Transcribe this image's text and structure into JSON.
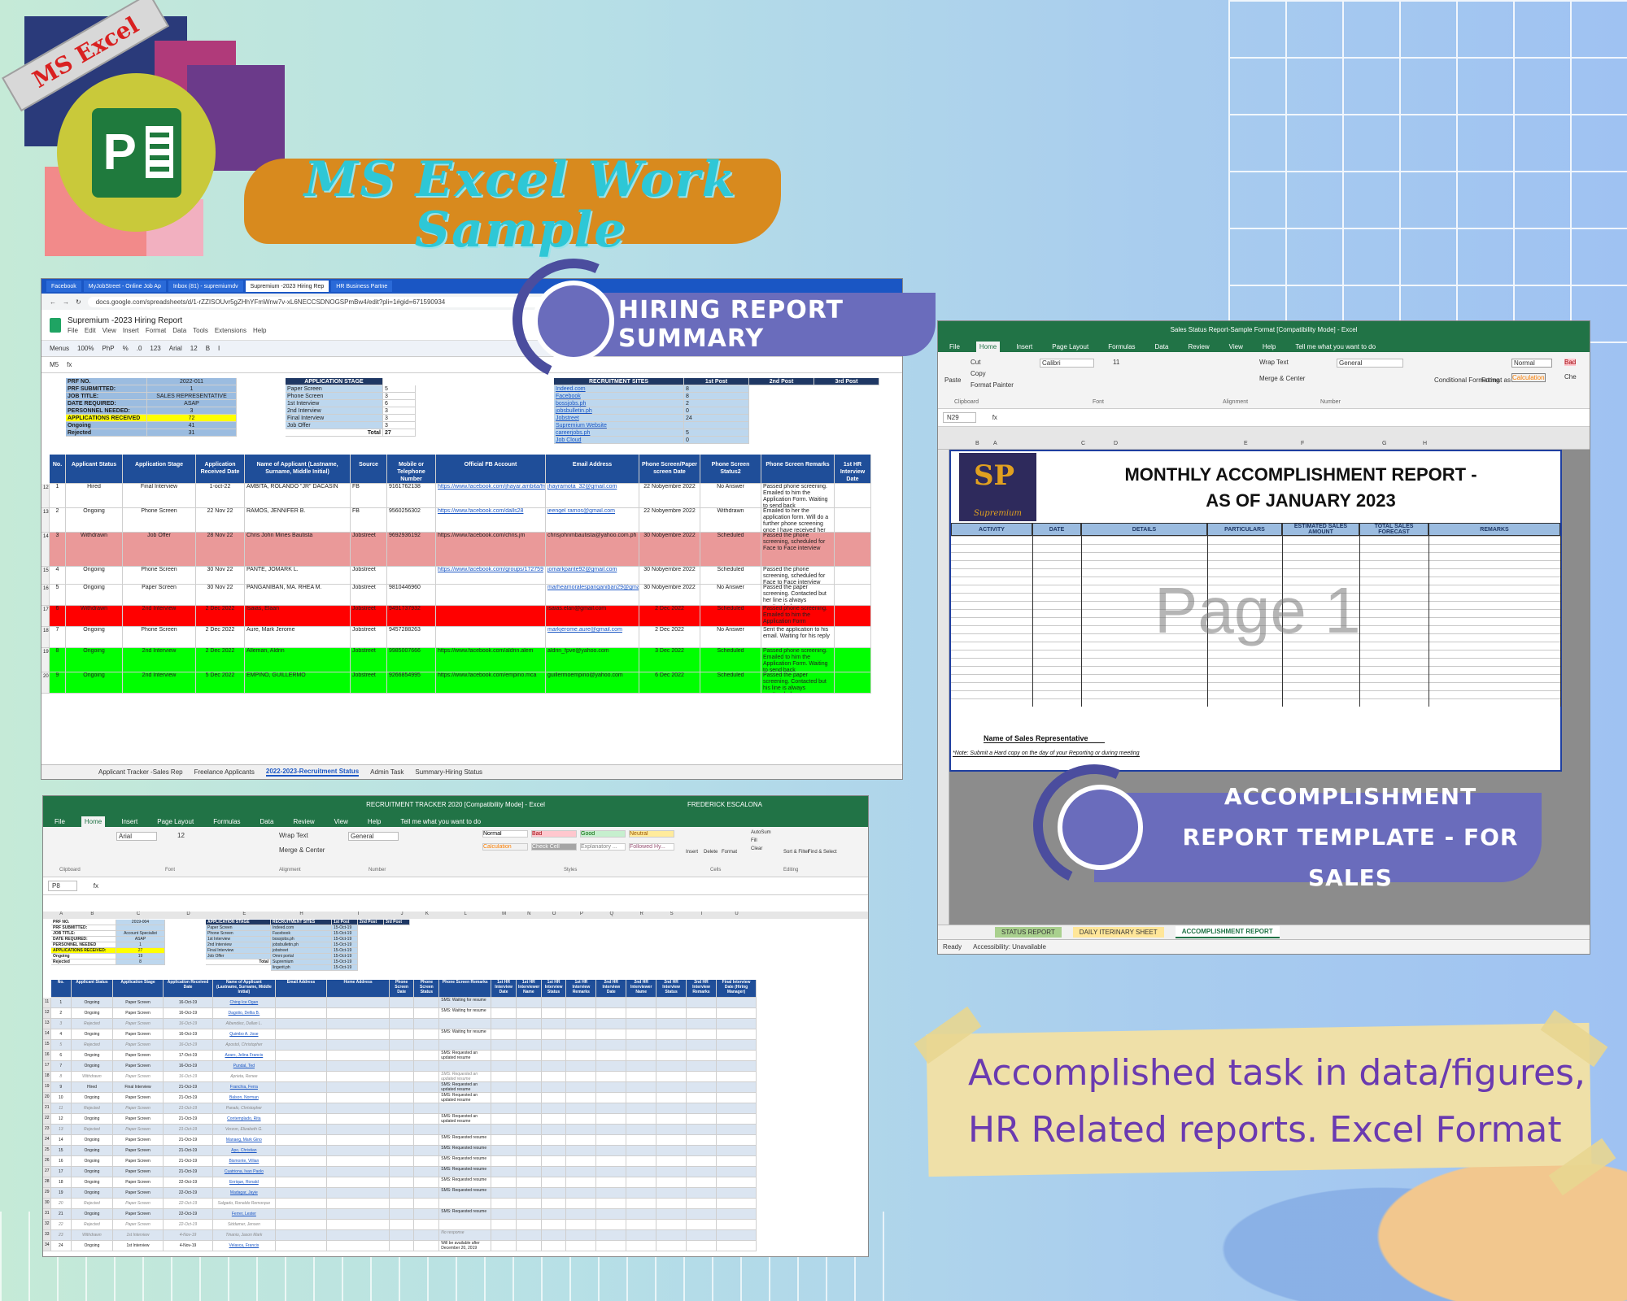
{
  "logo": {
    "ribbon_text": "MS Excel",
    "letter": "P"
  },
  "title": "MS Excel Work Sample",
  "labels": {
    "hiring": "HIRING REPORT SUMMARY",
    "accomplishment": "ACCOMPLISHMENT REPORT TEMPLATE - FOR SALES"
  },
  "note": "Accomplished task in data/figures, HR Related reports. Excel Format",
  "hiring_window": {
    "tabs": [
      "Facebook",
      "MyJobStreet - Online Job Ap",
      "Inbox (81) - supremiumdv",
      "Supremium -2023 Hiring Rep",
      "HR Business Partne"
    ],
    "url": "docs.google.com/spreadsheets/d/1-rZZISOUvr5gZHhYFmWnw7v-xL6NECCSDNOGSPmBw4/edit?pli=1#gid=671590934",
    "doc_title": "Supremium -2023 Hiring Report",
    "menu": [
      "File",
      "Edit",
      "View",
      "Insert",
      "Format",
      "Data",
      "Tools",
      "Extensions",
      "Help"
    ],
    "toolbar": [
      "Menus",
      "100%",
      "PhP",
      "%",
      ".0",
      "123",
      "Arial",
      "12",
      "B",
      "I"
    ],
    "cell_ref": "M5",
    "summary": [
      {
        "label": "PRF NO.",
        "value": "2022-011"
      },
      {
        "label": "PRF SUBMITTED:",
        "value": "1"
      },
      {
        "label": "JOB TITLE:",
        "value": "SALES REPRESENTATIVE"
      },
      {
        "label": "DATE REQUIRED:",
        "value": "ASAP"
      },
      {
        "label": "PERSONNEL NEEDED:",
        "value": "3"
      },
      {
        "label": "APPLICATIONS RECEIVED",
        "value": "72"
      },
      {
        "label": "Ongoing",
        "value": "41"
      },
      {
        "label": "Rejected",
        "value": "31"
      }
    ],
    "stage_header": "APPLICATION STAGE",
    "stages": [
      "Paper Screen",
      "Phone Screen",
      "1st Interview",
      "2nd Interview",
      "Final Interview",
      "Job Offer"
    ],
    "stage_counts": [
      "5",
      "3",
      "6",
      "3",
      "3",
      "3"
    ],
    "stage_total_label": "Total",
    "stage_total": "27",
    "sites_header": "RECRUITMENT SITES",
    "sites": [
      "Indeed.com",
      "Facebook",
      "bossjobs.ph",
      "jobsbulletin.ph",
      "Jobstreet",
      "Supremium Website",
      "careerjobs.ph",
      "Job Cloud"
    ],
    "site_counts": [
      "8",
      "8",
      "2",
      "0",
      "24",
      "",
      "5",
      "0"
    ],
    "post_headers": [
      "1st Post",
      "2nd Post",
      "3rd Post"
    ],
    "columns": [
      "No.",
      "Applicant Status",
      "Application Stage",
      "Application Received Date",
      "Name of Applicant (Lastname, Surname, Middle Initial)",
      "Source",
      "Mobile or Telephone Number",
      "Official FB Account",
      "Email Address",
      "Phone Screen/Paper screen Date",
      "Phone Screen Status2",
      "Phone Screen Remarks",
      "1st HR Interview Date"
    ],
    "rows": [
      {
        "no": "1",
        "status": "Hired",
        "stage": "Final Interview",
        "date": "1-oct-22",
        "name": "AMBITA, ROLANDO \"JR\" DACASIN",
        "source": "FB",
        "phone": "9161762138",
        "fb": "https://www.facebook.com/jhayar.ambita/friends",
        "email": "jhayramota_32@gmail.com",
        "ps_date": "22 Nobyembre 2022",
        "ps_status": "No Answer",
        "remarks": "Passed phone screening. Emailed to him the Application Form. Waiting to send back",
        "color": "#ffffff"
      },
      {
        "no": "2",
        "status": "Ongoing",
        "stage": "Phone Screen",
        "date": "22 Nov 22",
        "name": "RAMOS, JENNIFER B.",
        "source": "FB",
        "phone": "9560256302",
        "fb": "https://www.facebook.com/dalls28",
        "email": "jeengel ramos@gmail.com",
        "ps_date": "22 Nobyembre 2022",
        "ps_status": "Withdrawn",
        "remarks": "Emailed to her the application form. Will do a further phone screening once I have received her filled up form",
        "color": "#ffffff"
      },
      {
        "no": "3",
        "status": "Withdrawn",
        "stage": "Job Offer",
        "date": "28 Nov 22",
        "name": "Chris John Mines Bautista",
        "source": "Jobstreet",
        "phone": "9692936192",
        "fb": "https://www.facebook.com/chris.jm",
        "email": "chrisjohnmbautista@yahoo.com.ph",
        "ps_date": "30 Nobyembre 2022",
        "ps_status": "Scheduled",
        "remarks": "Passed the phone screening, scheduled for Face to Face interview",
        "color": "#ea9999"
      },
      {
        "no": "4",
        "status": "Ongoing",
        "stage": "Phone Screen",
        "date": "30 Nov 22",
        "name": "PANTE, JOMARK L.",
        "source": "Jobstreet",
        "phone": "",
        "fb": "https://www.facebook.com/groups/172759",
        "email": "jomarkpante92@gmail.com",
        "ps_date": "30 Nobyembre 2022",
        "ps_status": "Scheduled",
        "remarks": "Passed the phone screening, scheduled for Face to Face interview",
        "color": "#ffffff"
      },
      {
        "no": "5",
        "status": "Ongoing",
        "stage": "Paper Screen",
        "date": "30 Nov 22",
        "name": "PANGANIBAN, MA. RHEA M.",
        "source": "Jobstreet",
        "phone": "9810446960",
        "fb": "",
        "email": "marheamoralespanganiban29@gmail.com",
        "ps_date": "30 Nobyembre 2022",
        "ps_status": "No Answer",
        "remarks": "Passed the paper screening. Contacted but her line is always unattended",
        "color": "#ffffff"
      },
      {
        "no": "6",
        "status": "Withdrawn",
        "stage": "2nd Interview",
        "date": "2 Dec 2022",
        "name": "Isaias, Elaan",
        "source": "Jobstreet",
        "phone": "9491737932",
        "fb": "",
        "email": "isaias.elan@gmail.com",
        "ps_date": "2 Dec 2022",
        "ps_status": "Scheduled",
        "remarks": "Passed phone screening. Emailed to him the Application Form",
        "color": "#ff0000"
      },
      {
        "no": "7",
        "status": "Ongoing",
        "stage": "Phone Screen",
        "date": "2 Dec 2022",
        "name": "Aure, Mark Jerome",
        "source": "Jobstreet",
        "phone": "9457288263",
        "fb": "",
        "email": "markjerome.aure@gmail.com",
        "ps_date": "2 Dec 2022",
        "ps_status": "No Answer",
        "remarks": "Sent the application to his email. Waiting for his reply",
        "color": "#ffffff"
      },
      {
        "no": "8",
        "status": "Ongoing",
        "stage": "2nd Interview",
        "date": "2 Dec 2022",
        "name": "Alleman, Aldrin",
        "source": "Jobstreet",
        "phone": "9985007666",
        "fb": "https://www.facebook.com/aldrin.alem",
        "email": "aldrin_fpve@yahoo.com",
        "ps_date": "3 Dec 2022",
        "ps_status": "Scheduled",
        "remarks": "Passed phone screening. Emailed to him the Application Form. Waiting to send back",
        "color": "#00ff00"
      },
      {
        "no": "9",
        "status": "Ongoing",
        "stage": "2nd Interview",
        "date": "5 Dec 2022",
        "name": "EMPINO, GUILLERMO",
        "source": "Jobstreet",
        "phone": "9266854995",
        "fb": "https://www.facebook.com/empino.mca",
        "email": "guillermoempino@yahoo.com",
        "ps_date": "6 Dec 2022",
        "ps_status": "Scheduled",
        "remarks": "Passed the paper screening. Contacted but his line is always unattended",
        "color": "#00ff00"
      }
    ],
    "row_numbers": [
      "12",
      "13",
      "14",
      "15",
      "16",
      "17",
      "18",
      "19",
      "20"
    ],
    "sheet_tabs": [
      "Applicant Tracker -Sales Rep",
      "Freelance Applicants",
      "2022-2023-Recruitment Status",
      "Admin Task",
      "Summary-Hiring Status"
    ]
  },
  "accomplishment_window": {
    "title": "Sales Status Report-Sample Format  [Compatibility Mode]  -  Excel",
    "menu": [
      "File",
      "Home",
      "Insert",
      "Page Layout",
      "Formulas",
      "Data",
      "Review",
      "View",
      "Help"
    ],
    "tell_me": "Tell me what you want to do",
    "ribbon": {
      "cut": "Cut",
      "copy": "Copy",
      "format_painter": "Format Painter",
      "paste": "Paste",
      "font": "Calibri",
      "size": "11",
      "wrap": "Wrap Text",
      "merge": "Merge & Center",
      "number_format": "General",
      "conditional": "Conditional Formatting",
      "format_table": "Format as Table",
      "style_normal": "Normal",
      "style_bad": "Bad",
      "style_calc": "Calculation",
      "style_check": "Che",
      "groups": [
        "Clipboard",
        "Font",
        "Alignment",
        "Number"
      ]
    },
    "cell_ref": "N29",
    "columns": [
      "A",
      "B",
      "C",
      "D",
      "E",
      "F",
      "G",
      "H"
    ],
    "logo_name": "Supremium",
    "report_title_1": "MONTHLY ACCOMPLISHMENT REPORT -",
    "report_title_2": "AS OF JANUARY 2023",
    "headers": [
      "ACTIVITY",
      "DATE",
      "DETAILS",
      "PARTICULARS",
      "ESTIMATED SALES AMOUNT",
      "TOTAL SALES FORECAST",
      "REMARKS"
    ],
    "watermark": "Page 1",
    "sales_rep_label": "Name of Sales Representative",
    "footnote": "*Note: Submit a Hard copy on the day of your Reporting or during meeting",
    "sheet_tabs": [
      "STATUS REPORT",
      "DAILY ITERINARY SHEET",
      "ACCOMPLISHMENT REPORT"
    ],
    "status": [
      "Ready",
      "Accessibility: Unavailable"
    ]
  },
  "tracker_window": {
    "title": "RECRUITMENT TRACKER 2020  [Compatibility Mode]  -  Excel",
    "user": "FREDERICK ESCALONA",
    "menu": [
      "File",
      "Home",
      "Insert",
      "Page Layout",
      "Formulas",
      "Data",
      "Review",
      "View",
      "Help"
    ],
    "tell_me": "Tell me what you want to do",
    "ribbon": {
      "font": "Arial",
      "size": "12",
      "wrap": "Wrap Text",
      "merge": "Merge & Center",
      "number_format": "General",
      "styles": [
        "Normal",
        "Bad",
        "Good",
        "Neutral",
        "Calculation",
        "Check Cell",
        "Explanatory ...",
        "Followed Hy..."
      ],
      "cells": [
        "Insert",
        "Delete",
        "Format"
      ],
      "editing": [
        "AutoSum",
        "Fill",
        "Clear",
        "Sort & Filter",
        "Find & Select"
      ],
      "groups": [
        "Clipboard",
        "Font",
        "Alignment",
        "Number",
        "Styles",
        "Cells",
        "Editing"
      ]
    },
    "cell_ref": "P8",
    "col_letters": [
      "A",
      "B",
      "C",
      "D",
      "E",
      "H",
      "I",
      "J",
      "K",
      "L",
      "M",
      "N",
      "O",
      "P",
      "Q",
      "R",
      "S",
      "T",
      "U"
    ],
    "summary": [
      {
        "label": "PRF NO.",
        "value": "2019-004"
      },
      {
        "label": "PRF SUBMITTED:",
        "value": ""
      },
      {
        "label": "JOB TITLE:",
        "value": "Account Specialist"
      },
      {
        "label": "DATE REQUIRED:",
        "value": "ASAP"
      },
      {
        "label": "PERSONNEL NEEDED",
        "value": "1"
      },
      {
        "label": "APPLICATIONS RECEIVED:",
        "value": "27"
      },
      {
        "label": "Ongoing",
        "value": "19"
      },
      {
        "label": "Rejected",
        "value": "8"
      }
    ],
    "stage_header": "APPLICATION STAGE",
    "stages": [
      "Paper Screen",
      "Phone Screen",
      "1st Interview",
      "2nd Interview",
      "Final Interview",
      "Job Offer"
    ],
    "stage_total_label": "Total",
    "sites_header": "RECRUITMENT SITES",
    "sites": [
      "Indeed.com",
      "Facebook",
      "bossjobs.ph",
      "jobsbulletin.ph",
      "jobstreet",
      "Omni portal",
      "Supremium",
      "lingerit.ph"
    ],
    "post_headers": [
      "1st Post",
      "2nd Post",
      "3rd Post"
    ],
    "post_dates": [
      "15-Oct-19",
      "15-Oct-19",
      "15-Oct-19",
      "15-Oct-19",
      "15-Oct-19",
      "15-Oct-19",
      "15-Oct-19",
      "15-Oct-19"
    ],
    "columns": [
      "No.",
      "Applicant Status",
      "Application Stage",
      "Application Received Date",
      "Name of Applicant (Lastname, Surname, Middle Initial)",
      "Email Address",
      "Home Address",
      "Phone Screen Date",
      "Phone Screen Status",
      "Phone Screen Remarks",
      "1st HR Interview Date",
      "1st HR Interviewer Name",
      "1st HR Interview Status",
      "1st HR Interview Remarks",
      "2nd HR Interview Date",
      "2nd HR Interviewer Name",
      "2nd HR Interview Status",
      "2nd HR Interview Remarks",
      "Final Interview Date (Hiring Manager)"
    ],
    "rows": [
      {
        "r": "11",
        "no": "1",
        "status": "Ongoing",
        "stage": "Paper Screen",
        "date": "16-Oct-19",
        "name": "Ching Ice Ogan",
        "remark": "SMS: Waiting for resume"
      },
      {
        "r": "12",
        "no": "2",
        "status": "Ongoing",
        "stage": "Paper Screen",
        "date": "16-Oct-19",
        "name": "Dagotio, Dellia B.",
        "remark": "SMS: Waiting for resume"
      },
      {
        "r": "13",
        "no": "3",
        "status": "Rejected",
        "stage": "Paper Screen",
        "date": "16-Oct-19",
        "name": "Albendiez, Dallan L.",
        "remark": ""
      },
      {
        "r": "14",
        "no": "4",
        "status": "Ongoing",
        "stage": "Paper Screen",
        "date": "16-Oct-19",
        "name": "Quimbo A. Jose",
        "remark": "SMS: Waiting for resume"
      },
      {
        "r": "15",
        "no": "5",
        "status": "Rejected",
        "stage": "Paper Screen",
        "date": "16-Oct-19",
        "name": "Apostol, Christopher",
        "remark": ""
      },
      {
        "r": "16",
        "no": "6",
        "status": "Ongoing",
        "stage": "Paper Screen",
        "date": "17-Oct-19",
        "name": "Azaro, Jelina Francis",
        "remark": "SMS: Requested an updated resume"
      },
      {
        "r": "17",
        "no": "7",
        "status": "Ongoing",
        "stage": "Paper Screen",
        "date": "16-Oct-19",
        "name": "Pundal, Ted",
        "remark": ""
      },
      {
        "r": "18",
        "no": "8",
        "status": "Withdrawn",
        "stage": "Paper Screen",
        "date": "16-Oct-19",
        "name": "Aprieta, Renee",
        "remark": "SMS: Requested an updated resume"
      },
      {
        "r": "19",
        "no": "9",
        "status": "Hired",
        "stage": "Final Interview",
        "date": "21-Oct-19",
        "name": "Franchia, Ferra",
        "remark": "SMS: Requested an updated resume"
      },
      {
        "r": "20",
        "no": "10",
        "status": "Ongoing",
        "stage": "Paper Screen",
        "date": "21-Oct-19",
        "name": "Balson, Norman",
        "remark": "SMS: Requested an updated resume"
      },
      {
        "r": "21",
        "no": "11",
        "status": "Rejected",
        "stage": "Paper Screen",
        "date": "21-Oct-19",
        "name": "Panalo, Christopher",
        "remark": ""
      },
      {
        "r": "22",
        "no": "12",
        "status": "Ongoing",
        "stage": "Paper Screen",
        "date": "21-Oct-19",
        "name": "Contemplado, Rita",
        "remark": "SMS: Requested an updated resume"
      },
      {
        "r": "23",
        "no": "13",
        "status": "Rejected",
        "stage": "Paper Screen",
        "date": "21-Oct-19",
        "name": "Verzon, Elizabeth G.",
        "remark": ""
      },
      {
        "r": "24",
        "no": "14",
        "status": "Ongoing",
        "stage": "Paper Screen",
        "date": "21-Oct-19",
        "name": "Manaeg, Mark Gino",
        "remark": "SMS: Requested resume"
      },
      {
        "r": "25",
        "no": "15",
        "status": "Ongoing",
        "stage": "Paper Screen",
        "date": "21-Oct-19",
        "name": "Apo, Christian",
        "remark": "SMS: Requested resume"
      },
      {
        "r": "26",
        "no": "16",
        "status": "Ongoing",
        "stage": "Paper Screen",
        "date": "21-Oct-19",
        "name": "Bismonte, Villian",
        "remark": "SMS: Requested resume"
      },
      {
        "r": "27",
        "no": "17",
        "status": "Ongoing",
        "stage": "Paper Screen",
        "date": "21-Oct-19",
        "name": "Cuatriona, Ivan Paolo",
        "remark": "SMS: Requested resume"
      },
      {
        "r": "28",
        "no": "18",
        "status": "Ongoing",
        "stage": "Paper Screen",
        "date": "22-Oct-19",
        "name": "Enrique, Ronald",
        "remark": "SMS: Requested resume"
      },
      {
        "r": "29",
        "no": "19",
        "status": "Ongoing",
        "stage": "Paper Screen",
        "date": "22-Oct-19",
        "name": "Madagar, Jayie",
        "remark": "SMS: Requested resume"
      },
      {
        "r": "30",
        "no": "20",
        "status": "Rejected",
        "stage": "Paper Screen",
        "date": "22-Oct-19",
        "name": "Salgado, Ronaldo Remorque",
        "remark": ""
      },
      {
        "r": "31",
        "no": "21",
        "status": "Ongoing",
        "stage": "Paper Screen",
        "date": "22-Oct-19",
        "name": "Ferrer, Lester",
        "remark": "SMS: Requested resume"
      },
      {
        "r": "32",
        "no": "22",
        "status": "Rejected",
        "stage": "Paper Screen",
        "date": "22-Oct-19",
        "name": "Siddamer, Jensen",
        "remark": ""
      },
      {
        "r": "33",
        "no": "23",
        "status": "Withdrawn",
        "stage": "1st Interview",
        "date": "4-Nov-19",
        "name": "Tinanio, Jason Mark",
        "remark": "No response"
      },
      {
        "r": "34",
        "no": "24",
        "status": "Ongoing",
        "stage": "1st Interview",
        "date": "4-Nov-19",
        "name": "Velasca, Francis",
        "remark": "Will be available after December 20, 2019"
      }
    ]
  }
}
